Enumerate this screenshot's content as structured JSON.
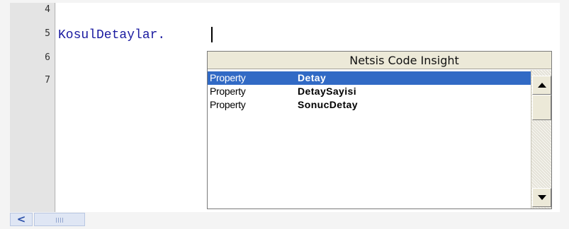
{
  "editor": {
    "line_numbers": [
      "4",
      "5",
      "6",
      "7"
    ],
    "code_line_5": "KosulDetaylar."
  },
  "insight": {
    "title": "Netsis Code Insight",
    "items": [
      {
        "kind": "Property",
        "name": "Detay",
        "selected": true
      },
      {
        "kind": "Property",
        "name": "DetaySayisi",
        "selected": false
      },
      {
        "kind": "Property",
        "name": "SonucDetay",
        "selected": false
      }
    ]
  },
  "scroll": {
    "left_arrow": "<"
  },
  "colors": {
    "selection": "#316ac5",
    "code_text": "#1a1aa0",
    "gutter": "#e4e4e4"
  }
}
